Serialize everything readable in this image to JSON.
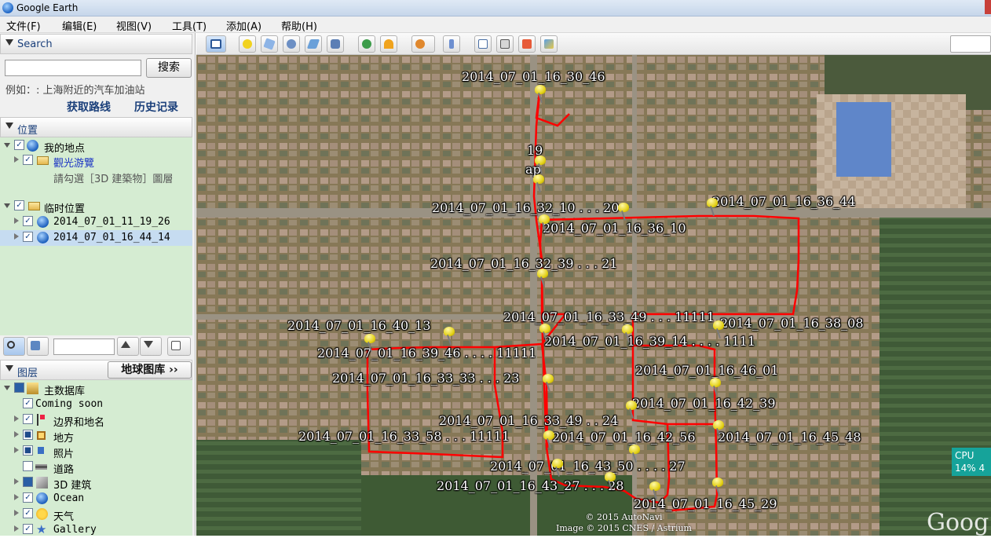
{
  "window": {
    "title": "Google Earth"
  },
  "menu": [
    "文件(F)",
    "编辑(E)",
    "视图(V)",
    "工具(T)",
    "添加(A)",
    "帮助(H)"
  ],
  "search": {
    "header": "Search",
    "button": "搜索",
    "placeholder": "",
    "hint": "例如：: 上海附近的汽车加油站",
    "links": [
      "获取路线",
      "历史记录"
    ]
  },
  "places": {
    "header": "位置",
    "items": [
      {
        "label": "我的地点",
        "indent": 0,
        "icon": "globe",
        "checked": true
      },
      {
        "label": "觀光游覽",
        "indent": 1,
        "icon": "folder",
        "checked": true,
        "link": true
      },
      {
        "label": "請勾選［3D 建築物］圖層",
        "indent": 2,
        "icon": "none",
        "checked": false,
        "note": true
      },
      {
        "label": "临时位置",
        "indent": 0,
        "icon": "folder-open",
        "checked": true
      },
      {
        "label": "2014_07_01_11_19_26",
        "indent": 1,
        "icon": "globe",
        "checked": true
      },
      {
        "label": "2014_07_01_16_44_14",
        "indent": 1,
        "icon": "globe",
        "checked": true,
        "selected": true
      }
    ]
  },
  "layers": {
    "header": "图层",
    "gallery_button": "地球图库 ››",
    "items": [
      {
        "label": "主数据库",
        "icon": "stack",
        "checked": "partial"
      },
      {
        "label": "Coming soon",
        "icon": "none",
        "checked": true
      },
      {
        "label": "边界和地名",
        "icon": "flag",
        "checked": true
      },
      {
        "label": "地方",
        "icon": "square",
        "checked": "partial"
      },
      {
        "label": "照片",
        "icon": "photo",
        "checked": "partial"
      },
      {
        "label": "道路",
        "icon": "road",
        "checked": false
      },
      {
        "label": "3D 建筑",
        "icon": "building",
        "checked": "partial"
      },
      {
        "label": "Ocean",
        "icon": "globe",
        "checked": true
      },
      {
        "label": "天气",
        "icon": "cloud",
        "checked": true
      },
      {
        "label": "Gallery",
        "icon": "star",
        "checked": true
      }
    ]
  },
  "map": {
    "labels": [
      "2014_07_01_16_30_46",
      "19",
      "ap",
      "2014_07_01_16_32_10 . . . 20",
      "2014_07_01_16_36_44",
      "2014_07_01_16_36_10",
      "2014_07_01_16_32_39 . . . 21",
      "2014_07_01_16_33_49 . . . 11111",
      "2014_07_01_16_38_08",
      "2014_07_01_16_40_13",
      "2014_07_01_16_39_14 . . . . 1111",
      "2014_07_01_16_39_46 . . . . 11111",
      "2014_07_01_16_46_01",
      "2014_07_01_16_33_33 . . . 23",
      "2014_07_01_16_42_39",
      "2014_07_01_16_33_49 . . 24",
      "2014_07_01_16_33_58 . . . 11111",
      "2014_07_01_16_42_56",
      "2014_07_01_16_45_48",
      "2014_07_01_16_43_50 . . . . 27",
      "2014_07_01_16_43_27 . . . 28",
      "2014_07_01_16_45_29"
    ],
    "copyright": [
      "© 2015 AutoNavi",
      "Image © 2015 CNES / Astrium"
    ],
    "logo": "Goog",
    "cpu": {
      "label": "CPU",
      "value": "14%",
      "extra": "4"
    }
  }
}
